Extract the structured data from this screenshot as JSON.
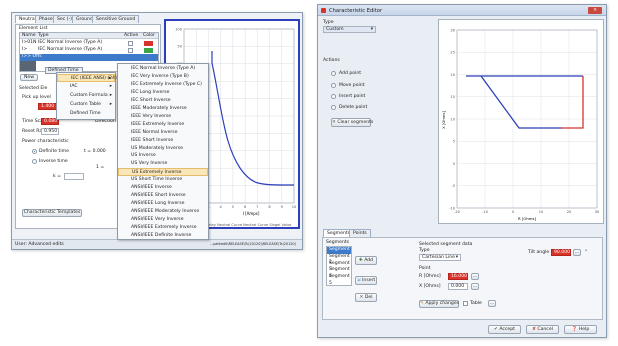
{
  "left_window": {
    "tabs": [
      "Neutral",
      "Phase",
      "Sec (-)",
      "Ground",
      "Sensitive Ground"
    ],
    "element_list_label": "Element List",
    "table_headers": [
      "Name",
      "Type",
      "Active",
      "Color"
    ],
    "rows": [
      {
        "name": "I>01N",
        "type": "IEC Normal Inverse (Type A)",
        "color": "#d9342b"
      },
      {
        "name": "I>",
        "type": "IEC Normal Inverse (Type A)",
        "color": "#3aa64a"
      },
      {
        "name": "I>> Offs",
        "type": "Defined Time"
      }
    ],
    "new_button": "New",
    "selected_label": "Selected Ele",
    "pickup_label": "Pick up level",
    "pickup_value": "1.400",
    "pickup_unit": "A  Set",
    "time_scale_label": "Time Scale",
    "time_scale_value": "0.080",
    "direction_label": "Direction",
    "reset_ratio_label": "Reset Ratio",
    "reset_ratio_value": "0.950",
    "power_label": "Power characteristic",
    "definite_time": "Definite time",
    "definite_value": "t = 0.000",
    "inverse_time": "Inverse time",
    "inverse_value": "1 =",
    "k_label": "k =",
    "characteristic_templates": "Characteristic Templates",
    "status_left": "User: Advanced edits",
    "status_right": "...pathedit\\RELEASE\\Tc(20120)\\RELEASE\\Tc(20120)",
    "plot_title": "Trip Characteristics",
    "plot_xlabel": "I [Amps]",
    "plot_legend": "Relay Neutral Curve  Neutral Curve  Singel Value",
    "plot_y_ticks": [
      "100",
      "50",
      "20",
      "10",
      "5",
      "2",
      "1",
      "0.5",
      "0.2",
      "0.1",
      "0.05"
    ],
    "plot_x_ticks": [
      "1",
      "2",
      "3",
      "4",
      "5",
      "6",
      "7",
      "8",
      "9",
      "10"
    ]
  },
  "dropdown": {
    "cell": "Defined Time",
    "submenu": [
      {
        "label": "IEC (IEEE ANSI) (24)",
        "arrow": true
      },
      {
        "label": "IAC",
        "arrow": true
      },
      {
        "label": "Custom Formula",
        "arrow": true
      },
      {
        "label": "Custom Table",
        "arrow": true
      },
      {
        "label": "Defined Time",
        "arrow": false
      }
    ],
    "items": [
      "IEC Normal Inverse (Type A)",
      "IEC Very Inverse (Type B)",
      "IEC Extremely Inverse (Type C)",
      "IEC Long Inverse",
      "IEC Short Inverse",
      "IEEE Moderately Inverse",
      "IEEE Very Inverse",
      "IEEE Extremely Inverse",
      "IEEE Normal Inverse",
      "IEEE Short Inverse",
      "US Moderately Inverse",
      "US Inverse",
      "US Very Inverse",
      "US Extremely Inverse",
      "US Short Time Inverse",
      "ANSI/IEEE Inverse",
      "ANSI/IEEE Short Inverse",
      "ANSI/IEEE Long Inverse",
      "ANSI/IEEE Moderately Inverse",
      "ANSI/IEEE Very Inverse",
      "ANSI/IEEE Extremely Inverse",
      "ANSI/IEEE Definite Inverse"
    ],
    "highlighted_index": 13
  },
  "char_editor": {
    "title": "Characteristic Editor",
    "type_label": "Type",
    "type_value": "Custom",
    "actions_label": "Actions",
    "actions": [
      "Add point",
      "Move point",
      "Insert point",
      "Delete point"
    ],
    "clear_segments": "Clear segments",
    "plot_y_label": "X [Ohms]",
    "plot_x_label": "R [Ohms]",
    "y_ticks": [
      "30",
      "25",
      "20",
      "15",
      "10",
      "5",
      "0",
      "-5",
      "-10"
    ],
    "x_ticks": [
      "-20",
      "-10",
      "0",
      "10",
      "20",
      "30"
    ],
    "tabs": [
      "Segments",
      "Points"
    ],
    "segments_label": "Segments",
    "segments": [
      "Segment 1",
      "Segment 2",
      "Segment 3",
      "Segment 4",
      "Segment 5"
    ],
    "selected_segment_index": 0,
    "add_button": "Add",
    "insert_button": "Insert",
    "del_button": "Del",
    "selected_data_label": "Selected segment data",
    "seg_type_label": "Type",
    "seg_type_value": "Cartesian Line",
    "point_label": "Point",
    "r_label": "R [Ohms]",
    "r_value": "16.000",
    "x_label": "X [Ohms]",
    "x_value": "0.000",
    "tilt_label": "Tilt angle",
    "tilt_value": "90.000",
    "tilt_unit": "°",
    "apply_button": "Apply changes",
    "table_label": "Table",
    "accept_button": "Accept",
    "cancel_button": "Cancel",
    "help_button": "Help"
  },
  "colors": {
    "accent_blue": "#2c3fb8",
    "curve_red": "#d9342b",
    "selection": "#3d7ac9"
  }
}
